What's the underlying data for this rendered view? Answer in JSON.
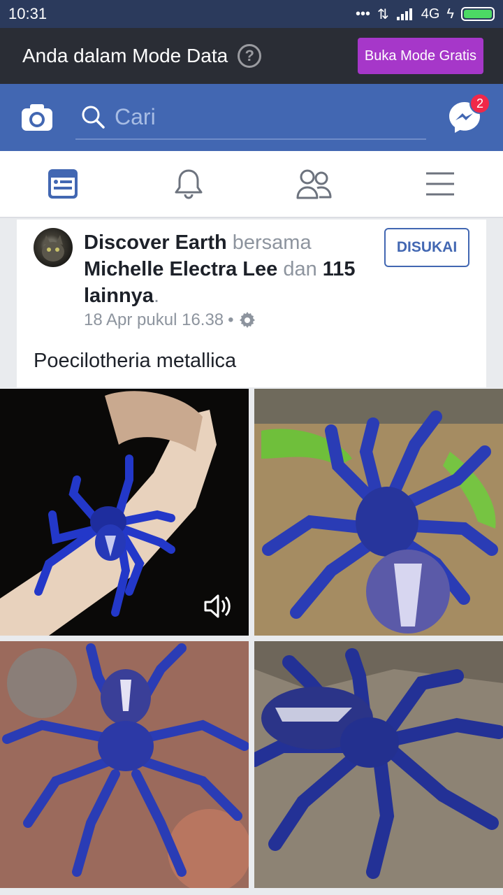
{
  "status": {
    "time": "10:31",
    "network": "4G"
  },
  "data_mode": {
    "text": "Anda dalam Mode Data",
    "help": "?",
    "button": "Buka Mode Gratis"
  },
  "header": {
    "search_placeholder": "Cari",
    "messenger_badge": "2"
  },
  "tabs": [
    {
      "icon": "news-feed-icon"
    },
    {
      "icon": "bell-icon"
    },
    {
      "icon": "friends-icon"
    },
    {
      "icon": "menu-icon"
    }
  ],
  "post": {
    "page_name": "Discover Earth",
    "with_text": "bersama",
    "tagged_name": "Michelle Electra Lee",
    "and_text": "dan",
    "others": "115 lainnya",
    "period": ".",
    "time": "18 Apr pukul 16.38",
    "separator": "•",
    "liked_button": "DISUKAI",
    "caption": "Poecilotheria metallica"
  },
  "colors": {
    "brand": "#4267b2",
    "data_button": "#a637c9",
    "badge": "#f02849"
  }
}
